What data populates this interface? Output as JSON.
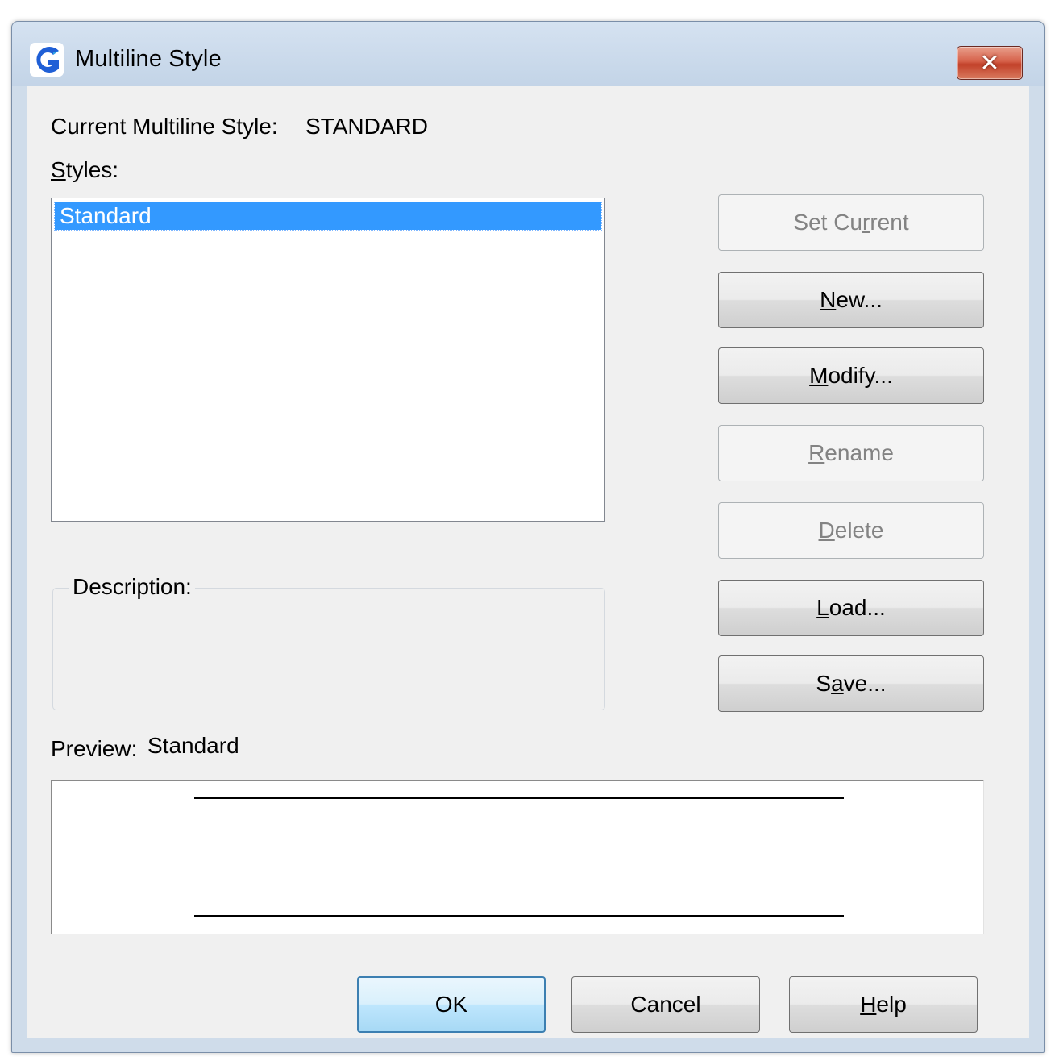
{
  "window": {
    "title": "Multiline Style",
    "app_icon": "gstarcad-logo-icon",
    "close_label": "✕"
  },
  "current_style": {
    "label": "Current Multiline Style:",
    "value": "STANDARD"
  },
  "styles": {
    "label_accel": "S",
    "label_rest": "tyles:",
    "items": [
      "Standard"
    ],
    "selected": "Standard"
  },
  "description": {
    "label": "Description:",
    "value": ""
  },
  "buttons": {
    "set_current": {
      "pre": "Set Cu",
      "accel": "r",
      "post": "rent",
      "enabled": false
    },
    "new": {
      "pre": "",
      "accel": "N",
      "post": "ew...",
      "enabled": true
    },
    "modify": {
      "pre": "",
      "accel": "M",
      "post": "odify...",
      "enabled": true
    },
    "rename": {
      "pre": "",
      "accel": "R",
      "post": "ename",
      "enabled": false
    },
    "delete": {
      "pre": "",
      "accel": "D",
      "post": "elete",
      "enabled": false
    },
    "load": {
      "pre": "",
      "accel": "L",
      "post": "oad...",
      "enabled": true
    },
    "save": {
      "pre": "S",
      "accel": "a",
      "post": "ve...",
      "enabled": true
    }
  },
  "preview": {
    "label": "Preview:",
    "style_name": "Standard"
  },
  "dialog_buttons": {
    "ok": "OK",
    "cancel": "Cancel",
    "help_accel": "H",
    "help_rest": "elp"
  },
  "colors": {
    "selection": "#3399ff",
    "close_button": "#c8452d",
    "default_button_border": "#3c7fb1"
  }
}
